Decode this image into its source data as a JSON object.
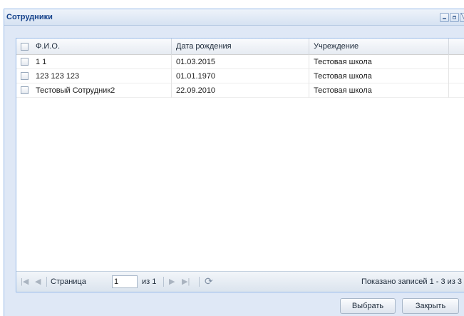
{
  "window": {
    "title": "Сотрудники"
  },
  "grid": {
    "columns": [
      "Ф.И.О.",
      "Дата рождения",
      "Учреждение"
    ],
    "rows": [
      {
        "name": "1 1",
        "birth_date": "01.03.2015",
        "institution": "Тестовая школа"
      },
      {
        "name": "123 123 123",
        "birth_date": "01.01.1970",
        "institution": "Тестовая школа"
      },
      {
        "name": "Тестовый Сотрудник2",
        "birth_date": "22.09.2010",
        "institution": "Тестовая школа"
      }
    ]
  },
  "pager": {
    "page_label": "Страница",
    "page_value": "1",
    "of_label": "из 1",
    "info": "Показано записей 1 - 3 из 3"
  },
  "buttons": {
    "select": "Выбрать",
    "close": "Закрыть"
  },
  "icons": {
    "first": "first-page-icon",
    "prev": "prev-page-icon",
    "next": "next-page-icon",
    "last": "last-page-icon",
    "refresh": "refresh-icon"
  }
}
